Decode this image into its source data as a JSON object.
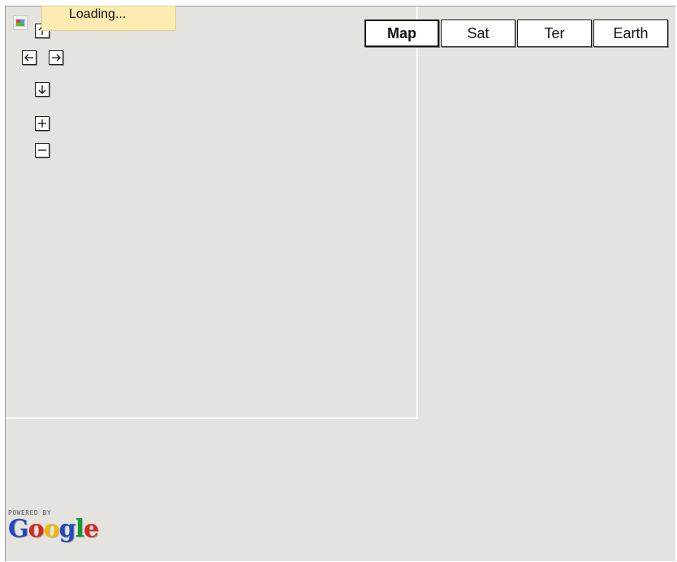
{
  "loading": {
    "text": "Loading..."
  },
  "map_types": [
    {
      "label": "Map",
      "selected": true
    },
    {
      "label": "Sat",
      "selected": false
    },
    {
      "label": "Ter",
      "selected": false
    },
    {
      "label": "Earth",
      "selected": false
    }
  ],
  "branding": {
    "powered_by": "POWERED BY",
    "logo_letters": [
      "G",
      "o",
      "o",
      "g",
      "l",
      "e"
    ],
    "logo_colors": [
      "#2549b8",
      "#d52b1e",
      "#f2b705",
      "#2549b8",
      "#159a34",
      "#d52b1e"
    ]
  },
  "controls": {
    "pan_up_icon": "arrow-up-icon",
    "pan_left_icon": "arrow-left-icon",
    "pan_right_icon": "arrow-right-icon",
    "pan_down_icon": "arrow-down-icon",
    "zoom_in_icon": "plus-icon",
    "zoom_out_icon": "minus-icon"
  },
  "colors": {
    "map_background": "#e5e3df",
    "loading_background": "#fdebb2"
  }
}
